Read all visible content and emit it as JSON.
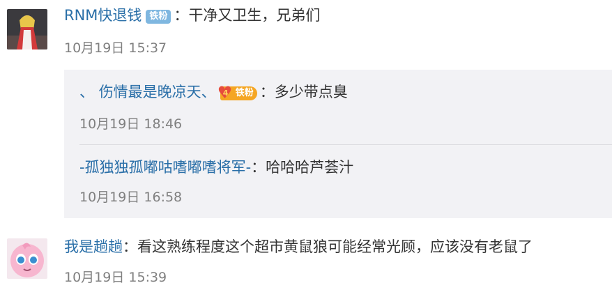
{
  "comments": [
    {
      "username": "RNM快退钱",
      "badge": "铁粉",
      "separator": "：",
      "text": "干净又卫生，兄弟们",
      "time": "10月19日 15:37",
      "replies": [
        {
          "prefix": "、",
          "username": "伤情最是晚凉天、",
          "badge_number": "4",
          "badge": "铁粉",
          "separator": "：",
          "text": "多少带点臭",
          "time": "10月19日 18:46"
        },
        {
          "username": "-孤独独孤嘟咕嗜嘟嗜将军-",
          "separator": "：",
          "text": "哈哈哈芦荟汁",
          "time": "10月19日 16:58"
        }
      ]
    },
    {
      "username": "我是趟趟",
      "separator": "：",
      "text": "看这熟练程度这个超市黄鼠狼可能经常光顾，应该没有老鼠了",
      "time": "10月19日 15:39"
    }
  ],
  "colors": {
    "username_blue": "#2a6fa8",
    "badge_blue": "#7fb7e0",
    "badge_gold": "#f5a623",
    "reply_bg": "#f2f2f5",
    "time_gray": "#808080"
  },
  "icons": {
    "avatar1": "anime-character-avatar",
    "avatar2": "jigglypuff-avatar",
    "badge_heart": "heart-level-icon"
  }
}
